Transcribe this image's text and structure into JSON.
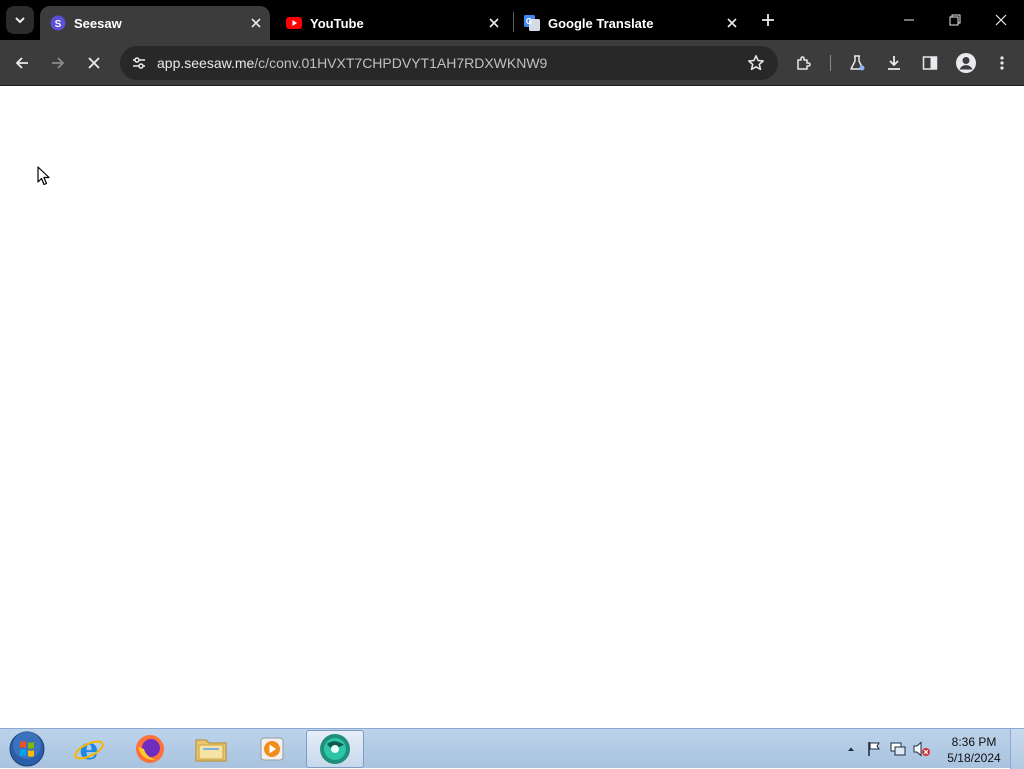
{
  "browser": {
    "tabs": [
      {
        "title": "Seesaw",
        "active": true,
        "icon": "seesaw-favicon"
      },
      {
        "title": "YouTube",
        "active": false,
        "icon": "youtube-favicon"
      },
      {
        "title": "Google Translate",
        "active": false,
        "icon": "google-translate-favicon"
      }
    ],
    "address_bar": {
      "host": "app.seesaw.me",
      "path": "/c/conv.01HVXT7CHPDVYT1AH7RDXWKNW9"
    },
    "colors": {
      "tabstrip": "#000000",
      "toolbar": "#3c3c3c",
      "omnibox": "#282828",
      "seesaw_purple": "#5b50d6",
      "youtube_red": "#ff0000",
      "translate_blue": "#4285f4"
    }
  },
  "taskbar": {
    "clock": {
      "time": "8:36 PM",
      "date": "5/18/2024"
    },
    "pinned": [
      "internet-explorer-icon",
      "firefox-icon",
      "file-explorer-icon",
      "media-player-icon",
      "chrome-app-icon"
    ]
  }
}
